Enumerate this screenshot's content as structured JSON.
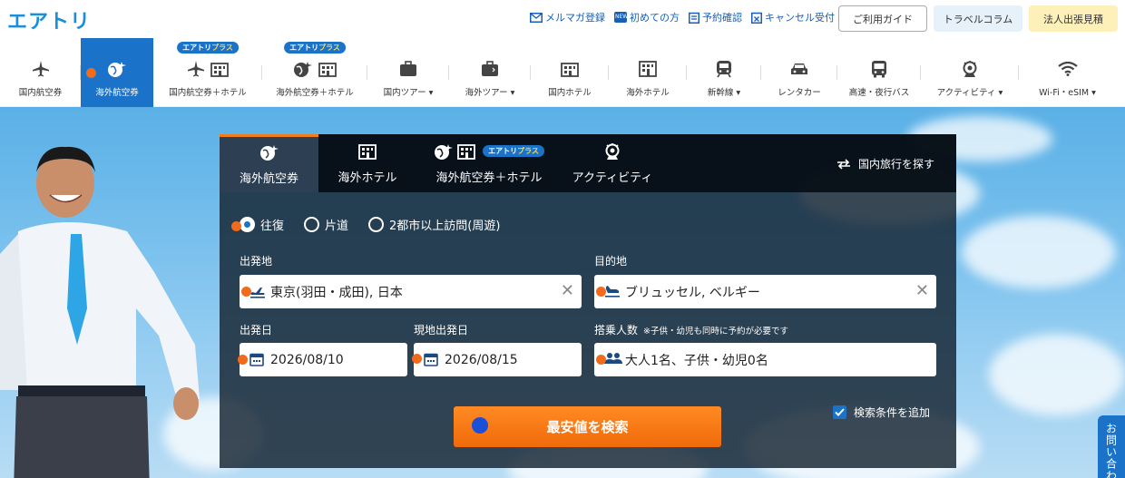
{
  "header": {
    "logo": "エアトリ",
    "links": [
      {
        "label": "メルマガ登録",
        "icon": "mail-icon"
      },
      {
        "label": "初めての方",
        "icon": "new-badge-icon",
        "badge": "NEW"
      },
      {
        "label": "予約確認",
        "icon": "list-icon"
      },
      {
        "label": "キャンセル受付",
        "icon": "calendar-x-icon"
      }
    ],
    "guide_label": "ご利用ガイド",
    "column_label": "トラベルコラム",
    "corp_label": "法人出張見積"
  },
  "nav": {
    "plus_brand": "エアトリ",
    "plus_suffix": "プラス",
    "items": [
      {
        "label": "国内航空券",
        "icon": "airplane-icon"
      },
      {
        "label": "海外航空券",
        "icon": "globe-plane-icon",
        "active": true
      },
      {
        "label": "国内航空券＋ホテル",
        "icon": "airplane-hotel-icon",
        "plus": true
      },
      {
        "label": "海外航空券＋ホテル",
        "icon": "globe-hotel-icon",
        "plus": true
      },
      {
        "label": "国内ツアー ▾",
        "icon": "suitcase-icon"
      },
      {
        "label": "海外ツアー ▾",
        "icon": "suitcase-icon"
      },
      {
        "label": "国内ホテル",
        "icon": "hotel-icon"
      },
      {
        "label": "海外ホテル",
        "icon": "hotel-icon"
      },
      {
        "label": "新幹線 ▾",
        "icon": "train-icon"
      },
      {
        "label": "レンタカー",
        "icon": "car-icon"
      },
      {
        "label": "高速・夜行バス",
        "icon": "bus-icon"
      },
      {
        "label": "アクティビティ ▾",
        "icon": "activity-icon"
      },
      {
        "label": "Wi-Fi・eSIM ▾",
        "icon": "wifi-icon"
      }
    ]
  },
  "search": {
    "tabs": [
      {
        "label": "海外航空券",
        "icon": "globe-plane-icon",
        "active": true
      },
      {
        "label": "海外ホテル",
        "icon": "hotel-icon"
      },
      {
        "label": "海外航空券＋ホテル",
        "icon": "globe-hotel-icon",
        "plus": true
      },
      {
        "label": "アクティビティ",
        "icon": "activity-icon"
      }
    ],
    "domestic_link": "国内旅行を探す",
    "trip_types": [
      {
        "label": "往復",
        "selected": true
      },
      {
        "label": "片道",
        "selected": false
      },
      {
        "label": "2都市以上訪問(周遊)",
        "selected": false
      }
    ],
    "departure_label": "出発地",
    "departure_value": "東京(羽田・成田), 日本",
    "destination_label": "目的地",
    "destination_value": "ブリュッセル, ベルギー",
    "depart_date_label": "出発日",
    "depart_date_value": "2026/08/10",
    "return_date_label": "現地出発日",
    "return_date_value": "2026/08/15",
    "passengers_label": "搭乗人数",
    "passengers_note": "※子供・幼児も同時に予約が必要です",
    "passengers_value": "大人1名、子供・幼児0名",
    "search_button": "最安値を検索",
    "add_conditions": "検索条件を追加"
  },
  "contact_tab": "お問い合わせ",
  "colors": {
    "brand": "#1a73c8",
    "accent": "#f07d17"
  }
}
